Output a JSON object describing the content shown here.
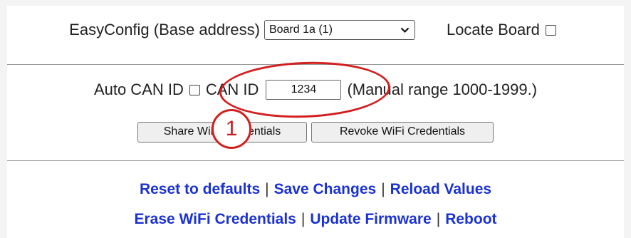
{
  "config": {
    "easyconfig_label": "EasyConfig (Base address)",
    "board_select_value": "Board 1a (1)",
    "locate_board_label": "Locate Board"
  },
  "can": {
    "auto_can_id_label": "Auto CAN ID",
    "can_id_label": "CAN ID",
    "can_id_value": "1234",
    "range_hint": "(Manual range 1000-1999.)"
  },
  "wifi_buttons": {
    "share_label": "Share WiFi Credentials",
    "revoke_label": "Revoke WiFi Credentials"
  },
  "links": {
    "reset": "Reset to defaults",
    "save": "Save Changes",
    "reload": "Reload Values",
    "erase": "Erase WiFi Credentials",
    "update": "Update Firmware",
    "reboot": "Reboot",
    "separator": "|"
  },
  "annotation": {
    "number": "1",
    "color": "#d31f1f"
  },
  "colors": {
    "link": "#1a31d6",
    "background": "#f4f4f4",
    "panel": "#ffffff"
  }
}
